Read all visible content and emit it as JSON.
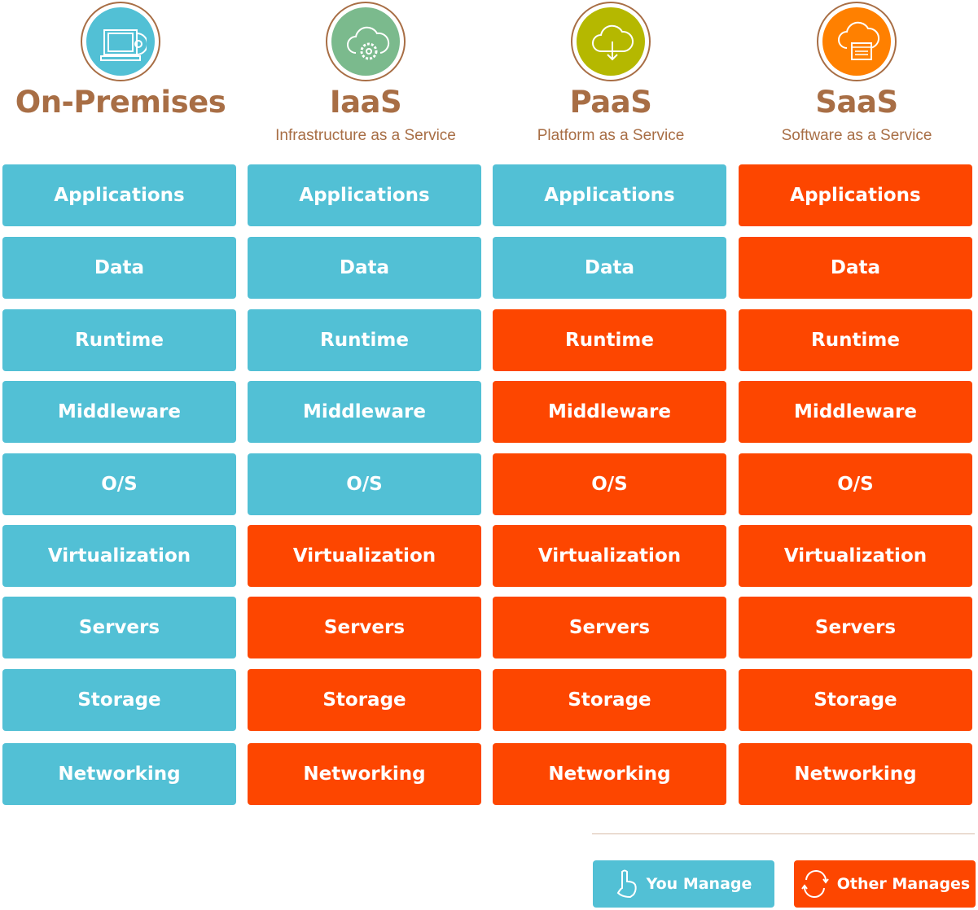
{
  "colors": {
    "you_manage": "#52C0D5",
    "other_manages": "#FD4600",
    "heading": "#A86E45"
  },
  "columns": [
    {
      "title": "On-Premises",
      "subtitle": "",
      "icon": "laptop-disc-icon",
      "icon_color": "#52C0D5",
      "cells": [
        {
          "label": "Applications",
          "managed_by": "you"
        },
        {
          "label": "Data",
          "managed_by": "you"
        },
        {
          "label": "Runtime",
          "managed_by": "you"
        },
        {
          "label": "Middleware",
          "managed_by": "you"
        },
        {
          "label": "O/S",
          "managed_by": "you"
        },
        {
          "label": "Virtualization",
          "managed_by": "you"
        },
        {
          "label": "Servers",
          "managed_by": "you"
        },
        {
          "label": "Storage",
          "managed_by": "you"
        },
        {
          "label": "Networking",
          "managed_by": "you"
        }
      ]
    },
    {
      "title": "IaaS",
      "subtitle": "Infrastructure as a Service",
      "icon": "cloud-gear-icon",
      "icon_color": "#7BBA8D",
      "cells": [
        {
          "label": "Applications",
          "managed_by": "you"
        },
        {
          "label": "Data",
          "managed_by": "you"
        },
        {
          "label": "Runtime",
          "managed_by": "you"
        },
        {
          "label": "Middleware",
          "managed_by": "you"
        },
        {
          "label": "O/S",
          "managed_by": "you"
        },
        {
          "label": "Virtualization",
          "managed_by": "other"
        },
        {
          "label": "Servers",
          "managed_by": "other"
        },
        {
          "label": "Storage",
          "managed_by": "other"
        },
        {
          "label": "Networking",
          "managed_by": "other"
        }
      ]
    },
    {
      "title": "PaaS",
      "subtitle": "Platform as a Service",
      "icon": "cloud-download-icon",
      "icon_color": "#B5B800",
      "cells": [
        {
          "label": "Applications",
          "managed_by": "you"
        },
        {
          "label": "Data",
          "managed_by": "you"
        },
        {
          "label": "Runtime",
          "managed_by": "other"
        },
        {
          "label": "Middleware",
          "managed_by": "other"
        },
        {
          "label": "O/S",
          "managed_by": "other"
        },
        {
          "label": "Virtualization",
          "managed_by": "other"
        },
        {
          "label": "Servers",
          "managed_by": "other"
        },
        {
          "label": "Storage",
          "managed_by": "other"
        },
        {
          "label": "Networking",
          "managed_by": "other"
        }
      ]
    },
    {
      "title": "SaaS",
      "subtitle": "Software as a Service",
      "icon": "cloud-browser-icon",
      "icon_color": "#FF8000",
      "cells": [
        {
          "label": "Applications",
          "managed_by": "other"
        },
        {
          "label": "Data",
          "managed_by": "other"
        },
        {
          "label": "Runtime",
          "managed_by": "other"
        },
        {
          "label": "Middleware",
          "managed_by": "other"
        },
        {
          "label": "O/S",
          "managed_by": "other"
        },
        {
          "label": "Virtualization",
          "managed_by": "other"
        },
        {
          "label": "Servers",
          "managed_by": "other"
        },
        {
          "label": "Storage",
          "managed_by": "other"
        },
        {
          "label": "Networking",
          "managed_by": "other"
        }
      ]
    }
  ],
  "legend": {
    "you_manage": "You Manage",
    "other_manages": "Other Manages"
  }
}
